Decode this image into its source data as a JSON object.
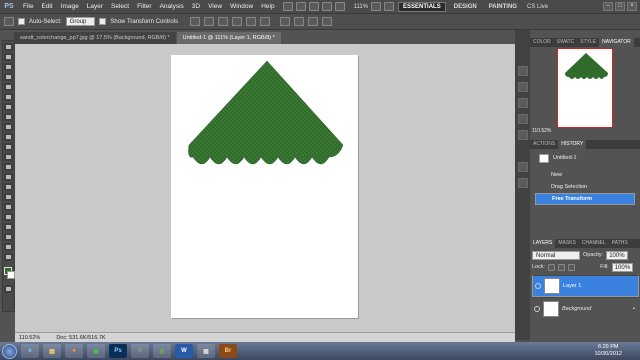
{
  "menubar": {
    "logo": "PS",
    "items": [
      "File",
      "Edit",
      "Image",
      "Layer",
      "Select",
      "Filter",
      "Analysis",
      "3D",
      "View",
      "Window",
      "Help"
    ],
    "zoom": "111%",
    "workspaces": [
      "ESSENTIALS",
      "DESIGN",
      "PAINTING"
    ],
    "cslive": "CS Live"
  },
  "options": {
    "auto_select_label": "Auto-Select:",
    "auto_select_value": "Group",
    "show_transform_label": "Show Transform Controls"
  },
  "doc_tabs": [
    "sandt_colorchange_pp7.jpg @ 17.5% (Background, RGB/8) *",
    "Untitled-1 @ 111% (Layer 1, RGB/8) *"
  ],
  "status": {
    "zoom": "110.52%",
    "doc": "Doc: 531.6K/516.7K"
  },
  "navigator": {
    "tabs": [
      "COLOR",
      "SWATC",
      "STYLE",
      "NAVIGATOR"
    ],
    "zoom": "110.52%"
  },
  "history": {
    "tabs": [
      "ACTIONS",
      "HISTORY"
    ],
    "items": [
      "Untitled-1",
      "New",
      "Drag Selection",
      "Free Transform"
    ],
    "selected": 3
  },
  "layers": {
    "tabs": [
      "LAYERS",
      "MASKS",
      "CHANNEL",
      "PATHS"
    ],
    "blend": "Normal",
    "opacity_label": "Opacity:",
    "opacity": "100%",
    "lock_label": "Lock:",
    "fill_label": "Fill:",
    "fill": "100%",
    "items": [
      "Layer 1",
      "Background"
    ]
  },
  "taskbar": {
    "time": "6:29 PM",
    "date": "10/30/2012"
  },
  "colors": {
    "fg": "#2f6b2b",
    "shape": "#2f6b2b",
    "accent": "#3b82e0"
  }
}
